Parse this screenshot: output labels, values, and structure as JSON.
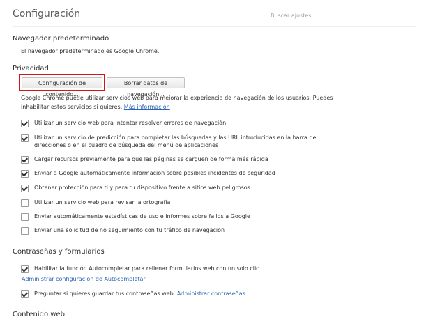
{
  "page_title": "Configuración",
  "search": {
    "placeholder": "Buscar ajustes"
  },
  "default_browser": {
    "title": "Navegador predeterminado",
    "text": "El navegador predeterminado es Google Chrome."
  },
  "privacy": {
    "title": "Privacidad",
    "content_settings_button": "Configuración de contenido...",
    "clear_data_button": "Borrar datos de navegación...",
    "description_line1": "Google Chrome puede utilizar servicios web para mejorar la experiencia de navegación de los usuarios. Puedes",
    "description_line2": "inhabilitar estos servicios si quieres.",
    "more_info_link": "Más información",
    "options": [
      {
        "label": "Utilizar un servicio web para intentar resolver errores de navegación",
        "checked": true
      },
      {
        "label": "Utilizar un servicio de predicción para completar las búsquedas y las URL introducidas en la barra de",
        "label2": "direcciones o en el cuadro de búsqueda del menú de aplicaciones",
        "checked": true
      },
      {
        "label": "Cargar recursos previamente para que las páginas se carguen de forma más rápida",
        "checked": true
      },
      {
        "label": "Enviar a Google automáticamente información sobre posibles incidentes de seguridad",
        "checked": true
      },
      {
        "label": "Obtener protección para ti y para tu dispositivo frente a sitios web peligrosos",
        "checked": true
      },
      {
        "label": "Utilizar un servicio web para revisar la ortografía",
        "checked": false
      },
      {
        "label": "Enviar automáticamente estadísticas de uso e informes sobre fallos a Google",
        "checked": false
      },
      {
        "label": "Enviar una solicitud de no seguimiento con tu tráfico de navegación",
        "checked": false
      }
    ]
  },
  "passwords": {
    "title": "Contraseñas y formularios",
    "autofill_label": "Habilitar la función Autocompletar para rellenar formularios web con un solo clic",
    "autofill_checked": true,
    "autofill_link": "Administrar configuración de Autocompletar",
    "save_passwords_label": "Preguntar si quieres guardar tus contraseñas web.",
    "save_passwords_checked": true,
    "manage_passwords_link": "Administrar contraseñas"
  },
  "web_content": {
    "title": "Contenido web"
  }
}
